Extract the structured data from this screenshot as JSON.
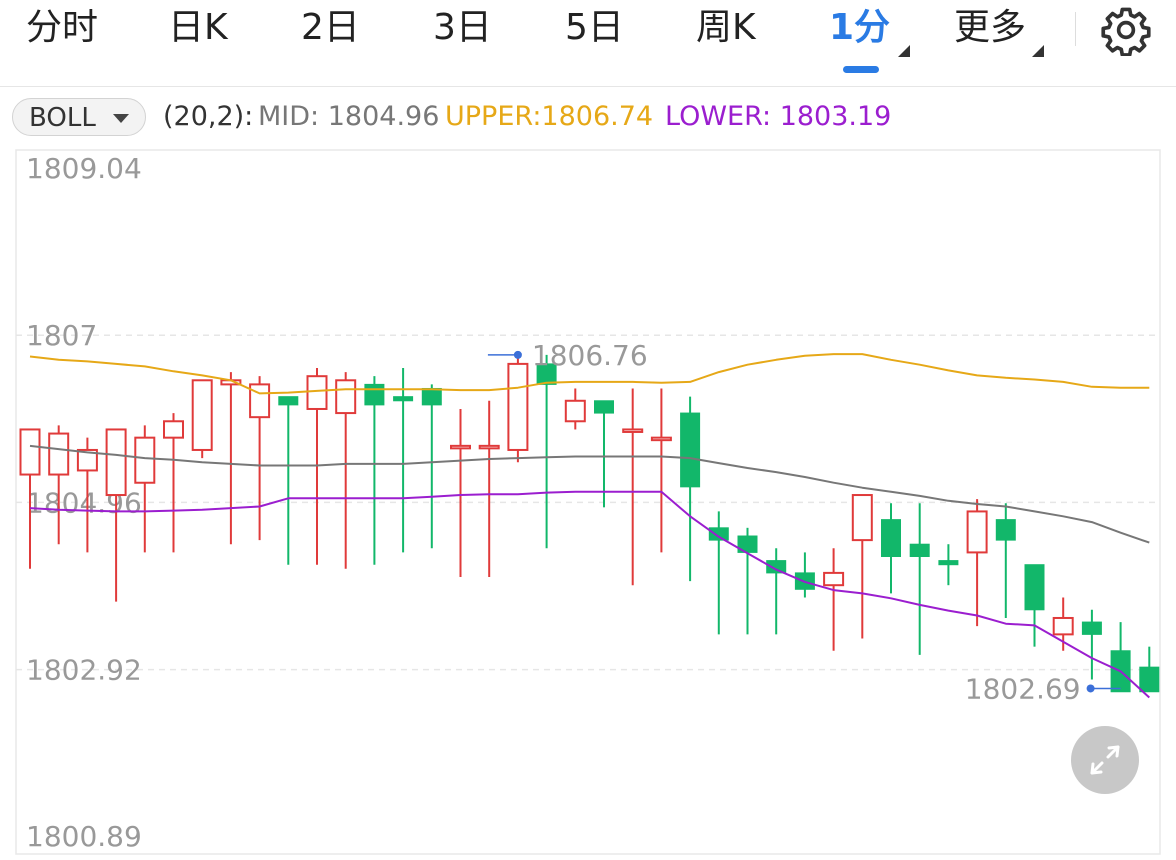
{
  "tabs": [
    {
      "label": "分时"
    },
    {
      "label": "日K"
    },
    {
      "label": "2日"
    },
    {
      "label": "3日"
    },
    {
      "label": "5日"
    },
    {
      "label": "周K"
    },
    {
      "label": "1分"
    },
    {
      "label": "更多"
    }
  ],
  "active_tab": "1分",
  "indicator": {
    "name": "BOLL",
    "params": "(20,2):",
    "mid_text": "MID: 1804.96",
    "upper_text": "UPPER:1806.74",
    "lower_text": "LOWER: 1803.19"
  },
  "colors": {
    "accent": "#2a7be4",
    "up": "#e03a3a",
    "down": "#12b76a",
    "upper": "#e6a817",
    "mid": "#777777",
    "lower": "#9b1ecf"
  },
  "icons": [
    "gear-icon",
    "expand-icon",
    "chevron-down-icon"
  ],
  "chart_data": {
    "type": "candlestick",
    "y_ticks": [
      "1809.04",
      "1807",
      "1804.96",
      "1802.92",
      "1800.89"
    ],
    "ylim": [
      1800.89,
      1809.04
    ],
    "max_label": "1806.76",
    "min_label": "1802.69",
    "candles": [
      {
        "o": 1805.3,
        "h": 1805.85,
        "l": 1804.15,
        "c": 1805.85
      },
      {
        "o": 1805.3,
        "h": 1805.9,
        "l": 1804.45,
        "c": 1805.8
      },
      {
        "o": 1805.35,
        "h": 1805.75,
        "l": 1804.35,
        "c": 1805.6
      },
      {
        "o": 1805.05,
        "h": 1805.85,
        "l": 1803.75,
        "c": 1805.85
      },
      {
        "o": 1805.2,
        "h": 1805.9,
        "l": 1804.35,
        "c": 1805.75
      },
      {
        "o": 1805.75,
        "h": 1806.05,
        "l": 1804.35,
        "c": 1805.95
      },
      {
        "o": 1805.6,
        "h": 1806.45,
        "l": 1805.5,
        "c": 1806.45
      },
      {
        "o": 1806.4,
        "h": 1806.55,
        "l": 1804.45,
        "c": 1806.45
      },
      {
        "o": 1806.0,
        "h": 1806.5,
        "l": 1804.5,
        "c": 1806.4
      },
      {
        "o": 1806.25,
        "h": 1806.25,
        "l": 1804.2,
        "c": 1806.15
      },
      {
        "o": 1806.1,
        "h": 1806.6,
        "l": 1804.2,
        "c": 1806.5
      },
      {
        "o": 1806.05,
        "h": 1806.55,
        "l": 1804.15,
        "c": 1806.45
      },
      {
        "o": 1806.4,
        "h": 1806.5,
        "l": 1804.2,
        "c": 1806.15
      },
      {
        "o": 1806.25,
        "h": 1806.6,
        "l": 1804.35,
        "c": 1806.2
      },
      {
        "o": 1806.35,
        "h": 1806.4,
        "l": 1804.4,
        "c": 1806.15
      },
      {
        "o": 1805.65,
        "h": 1806.1,
        "l": 1804.05,
        "c": 1805.65
      },
      {
        "o": 1805.65,
        "h": 1806.2,
        "l": 1804.05,
        "c": 1805.65
      },
      {
        "o": 1805.6,
        "h": 1806.76,
        "l": 1805.45,
        "c": 1806.65
      },
      {
        "o": 1806.65,
        "h": 1806.76,
        "l": 1804.4,
        "c": 1806.4
      },
      {
        "o": 1805.95,
        "h": 1806.35,
        "l": 1805.85,
        "c": 1806.2
      },
      {
        "o": 1806.2,
        "h": 1806.2,
        "l": 1804.9,
        "c": 1806.05
      },
      {
        "o": 1805.85,
        "h": 1806.35,
        "l": 1803.95,
        "c": 1805.85
      },
      {
        "o": 1805.75,
        "h": 1806.35,
        "l": 1804.35,
        "c": 1805.75
      },
      {
        "o": 1806.05,
        "h": 1806.25,
        "l": 1804.0,
        "c": 1805.15
      },
      {
        "o": 1804.65,
        "h": 1804.85,
        "l": 1803.35,
        "c": 1804.5
      },
      {
        "o": 1804.55,
        "h": 1804.65,
        "l": 1803.35,
        "c": 1804.35
      },
      {
        "o": 1804.25,
        "h": 1804.4,
        "l": 1803.35,
        "c": 1804.1
      },
      {
        "o": 1804.1,
        "h": 1804.35,
        "l": 1803.8,
        "c": 1803.9
      },
      {
        "o": 1803.95,
        "h": 1804.4,
        "l": 1803.15,
        "c": 1804.1
      },
      {
        "o": 1804.5,
        "h": 1805.05,
        "l": 1803.3,
        "c": 1805.05
      },
      {
        "o": 1804.75,
        "h": 1804.95,
        "l": 1803.85,
        "c": 1804.3
      },
      {
        "o": 1804.45,
        "h": 1804.95,
        "l": 1803.1,
        "c": 1804.3
      },
      {
        "o": 1804.25,
        "h": 1804.45,
        "l": 1803.95,
        "c": 1804.2
      },
      {
        "o": 1804.35,
        "h": 1805.0,
        "l": 1803.45,
        "c": 1804.85
      },
      {
        "o": 1804.75,
        "h": 1804.95,
        "l": 1803.55,
        "c": 1804.5
      },
      {
        "o": 1804.2,
        "h": 1804.2,
        "l": 1803.2,
        "c": 1803.65
      },
      {
        "o": 1803.35,
        "h": 1803.8,
        "l": 1803.15,
        "c": 1803.55
      },
      {
        "o": 1803.5,
        "h": 1803.65,
        "l": 1802.8,
        "c": 1803.35
      },
      {
        "o": 1803.15,
        "h": 1803.5,
        "l": 1802.69,
        "c": 1802.65
      },
      {
        "o": 1802.95,
        "h": 1803.2,
        "l": 1802.85,
        "c": 1802.65
      }
    ],
    "mid_line": [
      1805.65,
      1805.61,
      1805.57,
      1805.54,
      1805.5,
      1805.48,
      1805.45,
      1805.43,
      1805.41,
      1805.41,
      1805.41,
      1805.43,
      1805.43,
      1805.43,
      1805.45,
      1805.47,
      1805.49,
      1805.5,
      1805.51,
      1805.52,
      1805.52,
      1805.52,
      1805.52,
      1805.5,
      1805.44,
      1805.38,
      1805.33,
      1805.27,
      1805.2,
      1805.14,
      1805.09,
      1805.04,
      1804.98,
      1804.94,
      1804.91,
      1804.85,
      1804.79,
      1804.72,
      1804.59,
      1804.47
    ],
    "upper_line": [
      1806.74,
      1806.7,
      1806.68,
      1806.65,
      1806.62,
      1806.56,
      1806.51,
      1806.45,
      1806.29,
      1806.3,
      1806.32,
      1806.34,
      1806.34,
      1806.34,
      1806.34,
      1806.33,
      1806.33,
      1806.36,
      1806.42,
      1806.43,
      1806.43,
      1806.43,
      1806.42,
      1806.43,
      1806.55,
      1806.64,
      1806.7,
      1806.75,
      1806.77,
      1806.77,
      1806.7,
      1806.64,
      1806.57,
      1806.51,
      1806.48,
      1806.46,
      1806.43,
      1806.37,
      1806.36,
      1806.36
    ],
    "lower_line": [
      1804.89,
      1804.87,
      1804.86,
      1804.85,
      1804.85,
      1804.86,
      1804.87,
      1804.89,
      1804.91,
      1805.01,
      1805.01,
      1805.01,
      1805.01,
      1805.01,
      1805.03,
      1805.05,
      1805.06,
      1805.06,
      1805.08,
      1805.09,
      1805.09,
      1805.09,
      1805.09,
      1804.79,
      1804.54,
      1804.34,
      1804.14,
      1803.99,
      1803.89,
      1803.85,
      1803.79,
      1803.71,
      1803.64,
      1803.58,
      1803.48,
      1803.46,
      1803.26,
      1803.06,
      1802.9,
      1802.58
    ]
  }
}
